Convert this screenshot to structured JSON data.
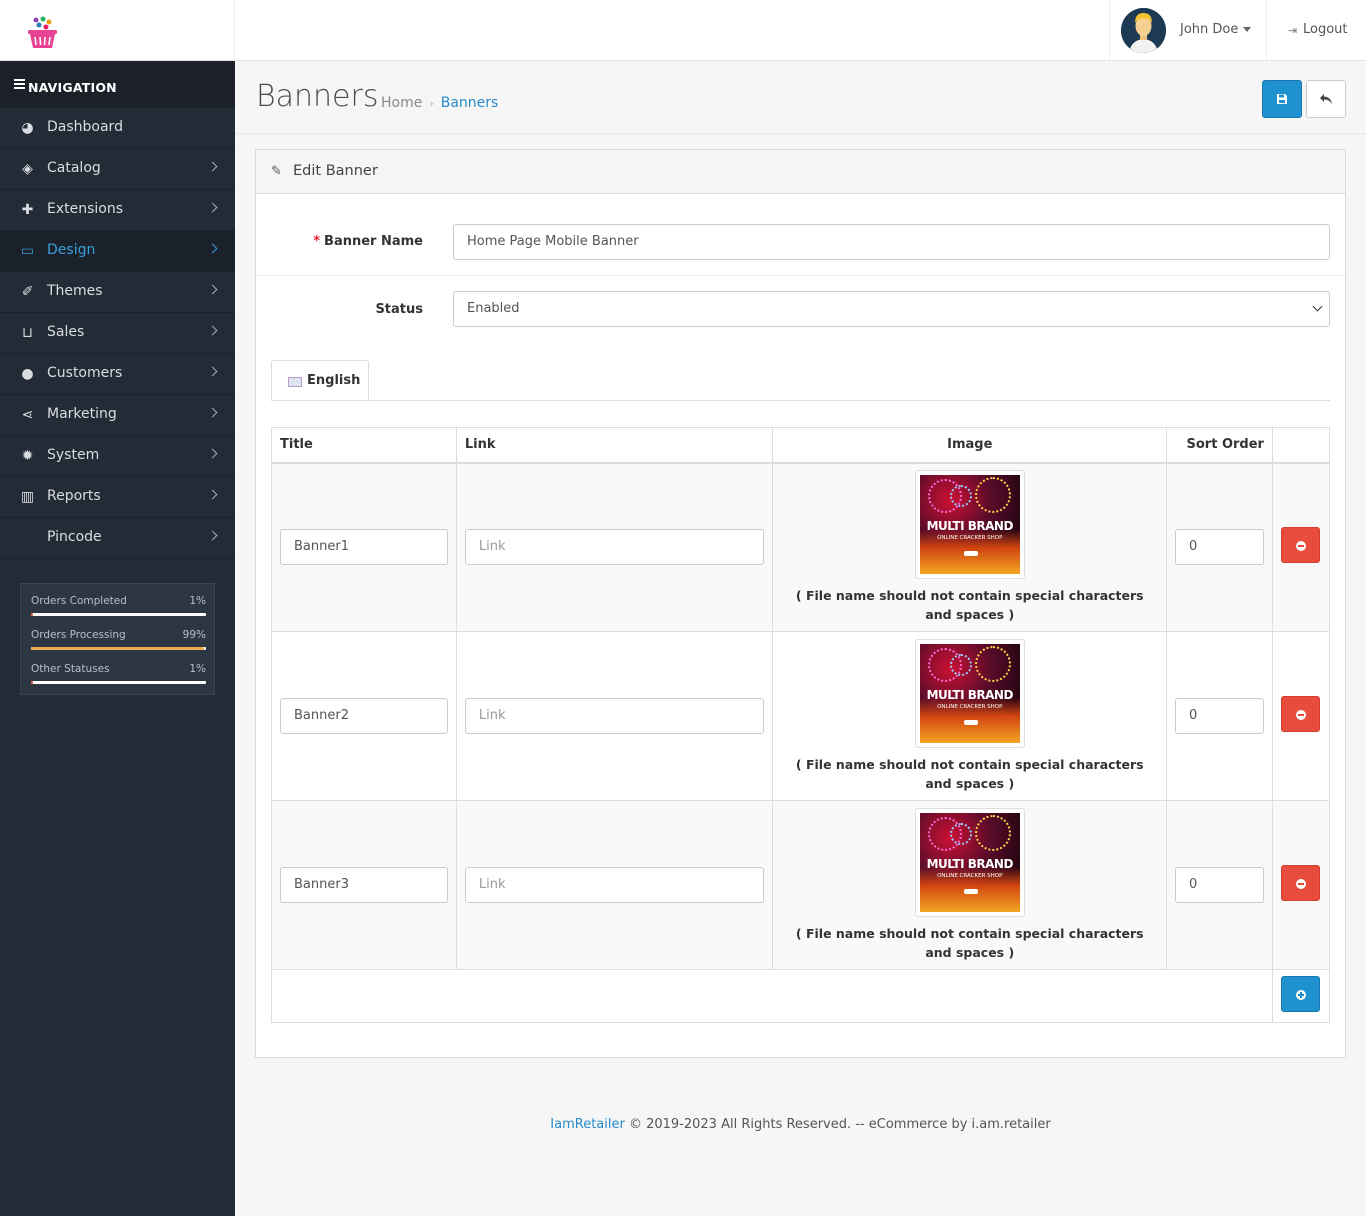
{
  "header": {
    "user_name": "John Doe",
    "logout_label": "Logout"
  },
  "sidebar": {
    "nav_title": "NAVIGATION",
    "items": [
      {
        "label": "Dashboard",
        "icon": "dashboard-icon",
        "active": false
      },
      {
        "label": "Catalog",
        "icon": "tags-icon",
        "active": false
      },
      {
        "label": "Extensions",
        "icon": "puzzle-icon",
        "active": false
      },
      {
        "label": "Design",
        "icon": "monitor-icon",
        "active": true
      },
      {
        "label": "Themes",
        "icon": "brush-icon",
        "active": false
      },
      {
        "label": "Sales",
        "icon": "cart-icon",
        "active": false
      },
      {
        "label": "Customers",
        "icon": "user-icon",
        "active": false
      },
      {
        "label": "Marketing",
        "icon": "share-icon",
        "active": false
      },
      {
        "label": "System",
        "icon": "gear-icon",
        "active": false
      },
      {
        "label": "Reports",
        "icon": "bar-chart-icon",
        "active": false
      },
      {
        "label": "Pincode",
        "icon": "",
        "active": false
      }
    ],
    "stats": [
      {
        "label": "Orders Completed",
        "pct": "1%",
        "value": 1,
        "color": "#ffffff"
      },
      {
        "label": "Orders Processing",
        "pct": "99%",
        "value": 99,
        "color": "#f0ad4e"
      },
      {
        "label": "Other Statuses",
        "pct": "1%",
        "value": 1,
        "color": "#ffffff"
      }
    ]
  },
  "page": {
    "title": "Banners",
    "breadcrumb": [
      "Home",
      "Banners"
    ]
  },
  "panel": {
    "title": "Edit Banner",
    "banner_name_label": "Banner Name",
    "banner_name_value": "Home Page Mobile Banner",
    "status_label": "Status",
    "status_value": "Enabled",
    "lang_tab": "English"
  },
  "table": {
    "headers": [
      "Title",
      "Link",
      "Image",
      "Sort Order"
    ],
    "link_placeholder": "Link",
    "image_text_1": "MULTI BRAND",
    "image_text_2": "ONLINE CRACKER SHOP",
    "hint": "( File name should not contain special characters and spaces )",
    "rows": [
      {
        "title": "Banner1",
        "sort": "0"
      },
      {
        "title": "Banner2",
        "sort": "0"
      },
      {
        "title": "Banner3",
        "sort": "0"
      }
    ]
  },
  "footer": {
    "brand": "IamRetailer",
    "text": " © 2019-2023 All Rights Reserved. -- eCommerce by i.am.retailer"
  },
  "colors": {
    "primary": "#1e91cf",
    "danger": "#e74c3c",
    "sidebar": "#232b36",
    "active_link": "#3a9fdc"
  }
}
